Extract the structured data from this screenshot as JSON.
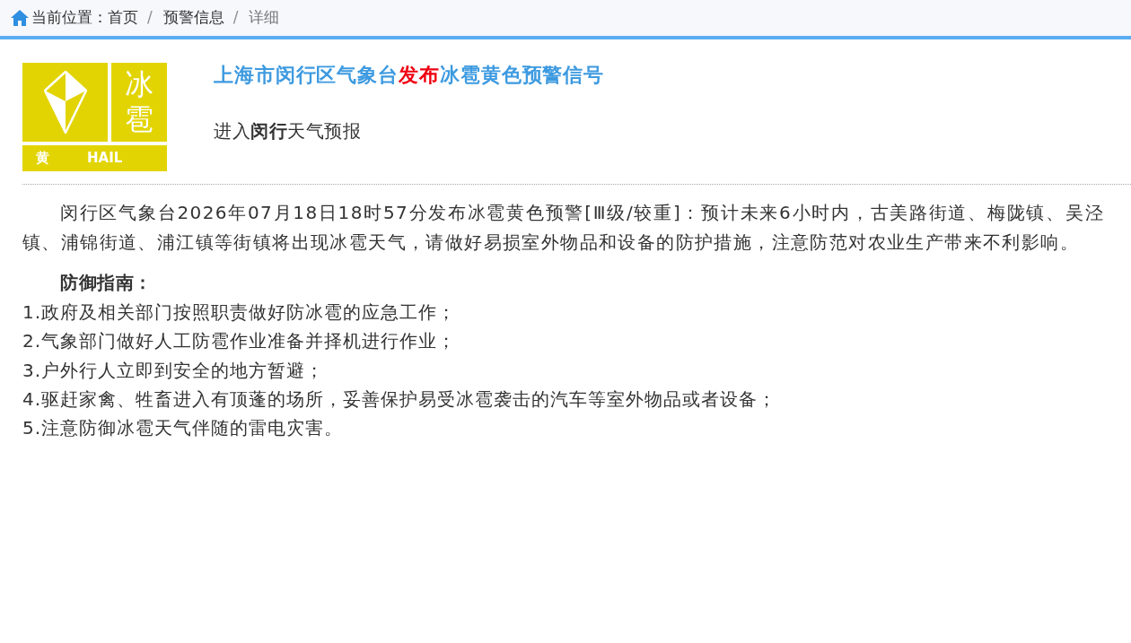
{
  "breadcrumb": {
    "label": "当前位置：",
    "items": [
      {
        "kind": "link",
        "text": "首页"
      },
      {
        "kind": "separator",
        "text": "/"
      },
      {
        "kind": "link",
        "text": "预警信息"
      },
      {
        "kind": "separator",
        "text": "/"
      },
      {
        "kind": "current",
        "text": "详细"
      }
    ]
  },
  "sign": {
    "name_chars": [
      "冰",
      "雹"
    ],
    "level": "黄",
    "english": "HAIL"
  },
  "title": {
    "parts": [
      {
        "text": "上海市闵行区气象台",
        "highlight": false
      },
      {
        "text": "发布",
        "highlight": true
      },
      {
        "text": "冰雹黄色预警信号",
        "highlight": false
      }
    ]
  },
  "forecast_link": "进入**闵行**天气预报",
  "paragraph": "闵行区气象台2026年07月18日18时57分发布冰雹黄色预警[Ⅲ级/较重]：预计未来6小时内，古美路街道、梅陇镇、吴泾镇、浦锦街道、浦江镇等街镇将出现冰雹天气，请做好易损室外物品和设备的防护措施，注意防范对农业生产带来不利影响。",
  "guide": {
    "heading": "防御指南：",
    "items": [
      "1.政府及相关部门按照职责做好防冰雹的应急工作；",
      "2.气象部门做好人工防雹作业准备并择机进行作业；",
      "3.户外行人立即到安全的地方暂避；",
      "4.驱赶家禽、牲畜进入有顶蓬的场所，妥善保护易受冰雹袭击的汽车等室外物品或者设备；",
      "5.注意防御冰雹天气伴随的雷电灾害。"
    ]
  }
}
